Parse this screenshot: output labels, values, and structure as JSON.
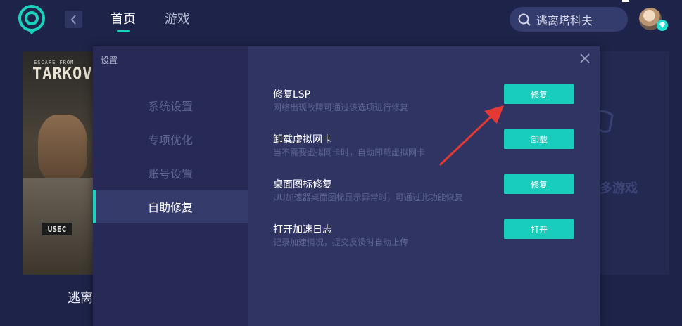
{
  "header": {
    "back_icon": "chevron-left-icon",
    "tabs": [
      {
        "label": "首页",
        "active": true
      },
      {
        "label": "游戏",
        "active": false
      }
    ],
    "search": {
      "value": "逃离塔科夫",
      "icon": "search-icon"
    },
    "accent_color": "#19d3be"
  },
  "background": {
    "game_card": {
      "art_small_text": "ESCAPE FROM",
      "art_title": "TARKOV",
      "art_patch": "USEC",
      "label": "逃离"
    },
    "right_card_text": "多游戏"
  },
  "modal": {
    "title": "设置",
    "sidebar": [
      {
        "label": "系统设置",
        "active": false
      },
      {
        "label": "专项优化",
        "active": false
      },
      {
        "label": "账号设置",
        "active": false
      },
      {
        "label": "自助修复",
        "active": true
      }
    ],
    "rows": [
      {
        "title": "修复LSP",
        "desc": "网络出现故障可通过该选项进行修复",
        "button": "修复"
      },
      {
        "title": "卸载虚拟网卡",
        "desc": "当不需要虚拟网卡时，自动卸载虚拟网卡",
        "button": "卸载"
      },
      {
        "title": "桌面图标修复",
        "desc": "UU加速器桌面图标显示异常时，可通过此功能恢复",
        "button": "修复"
      },
      {
        "title": "打开加速日志",
        "desc": "记录加速情况，提交反馈时自动上传",
        "button": "打开"
      }
    ],
    "button_color": "#19cdbd",
    "annotation_arrow_color": "#e53935"
  }
}
